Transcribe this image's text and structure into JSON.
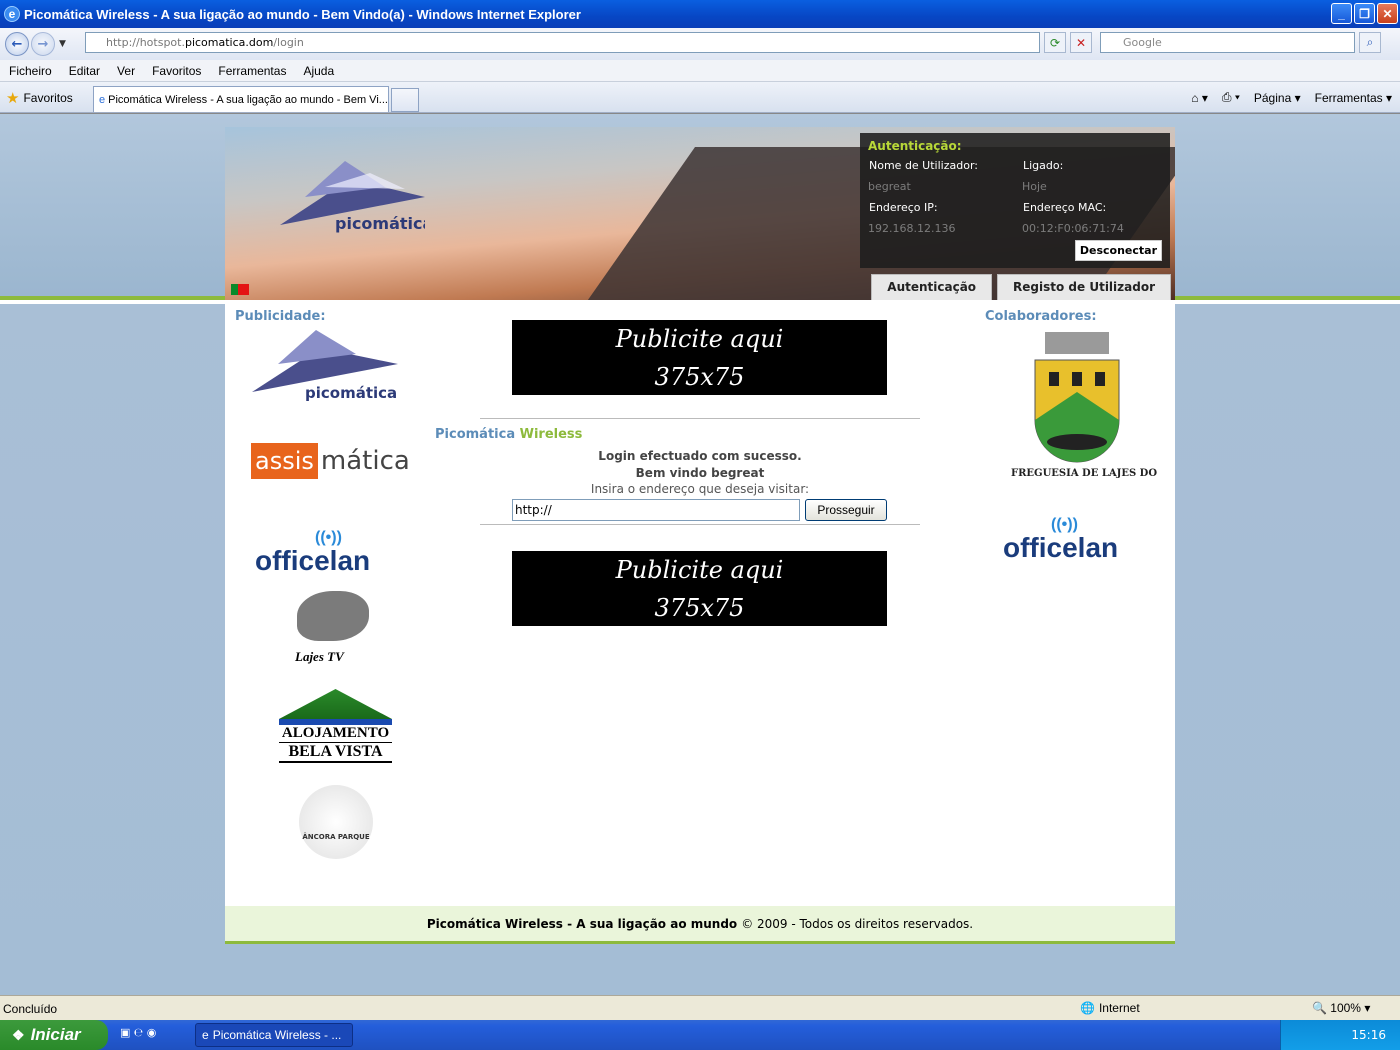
{
  "window": {
    "title": "Picomática Wireless - A sua ligação ao mundo - Bem Vindo(a) - Windows Internet Explorer"
  },
  "address": {
    "url_prefix": "http://hotspot.",
    "url_domain": "picomatica.dom",
    "url_path": "/login",
    "search_placeholder": "Google"
  },
  "menu": [
    "Ficheiro",
    "Editar",
    "Ver",
    "Favoritos",
    "Ferramentas",
    "Ajuda"
  ],
  "favbar": {
    "favorites_label": "Favoritos",
    "tab_title": "Picomática Wireless - A sua ligação ao mundo - Bem Vi...",
    "page_label": "Página",
    "tools_label": "Ferramentas"
  },
  "header": {
    "auth_title": "Autenticação:",
    "user_label": "Nome de Utilizador:",
    "user_value": "begreat",
    "connected_label": "Ligado:",
    "connected_value": "Hoje",
    "ip_label": "Endereço IP:",
    "ip_value": "192.168.12.136",
    "mac_label": "Endereço MAC:",
    "mac_value": "00:12:F0:06:71:74",
    "disconnect": "Desconectar",
    "tabs": [
      "Autenticação",
      "Registo de Utilizador"
    ],
    "logo_text": "picomática"
  },
  "left": {
    "title": "Publicidade:",
    "logos": [
      "picomática",
      "assis",
      "mática",
      "officelan",
      "Lajes TV",
      "ALOJAMENTO",
      "BELA VISTA",
      "ÂNCORA PARQUE"
    ]
  },
  "right": {
    "title": "Colaboradores:",
    "crest_text": "FREGUESIA DE LAJES DO PICO",
    "logo": "officelan"
  },
  "center": {
    "ad_line1": "Publicite aqui",
    "ad_line2": "375x75",
    "brand1": "Picomática",
    "brand2": "Wireless",
    "msg1": "Login efectuado com sucesso.",
    "msg2": "Bem vindo begreat",
    "hint": "Insira o endereço que deseja visitar:",
    "url_value": "http://",
    "button": "Prosseguir"
  },
  "footer": {
    "bold": "Picomática Wireless - A sua ligação ao mundo",
    "rest": "© 2009 - Todos os direitos reservados."
  },
  "status": {
    "left": "Concluído",
    "zone": "Internet",
    "zoom": "100%"
  },
  "taskbar": {
    "start": "Iniciar",
    "task": "Picomática Wireless - ...",
    "clock": "15:16"
  }
}
